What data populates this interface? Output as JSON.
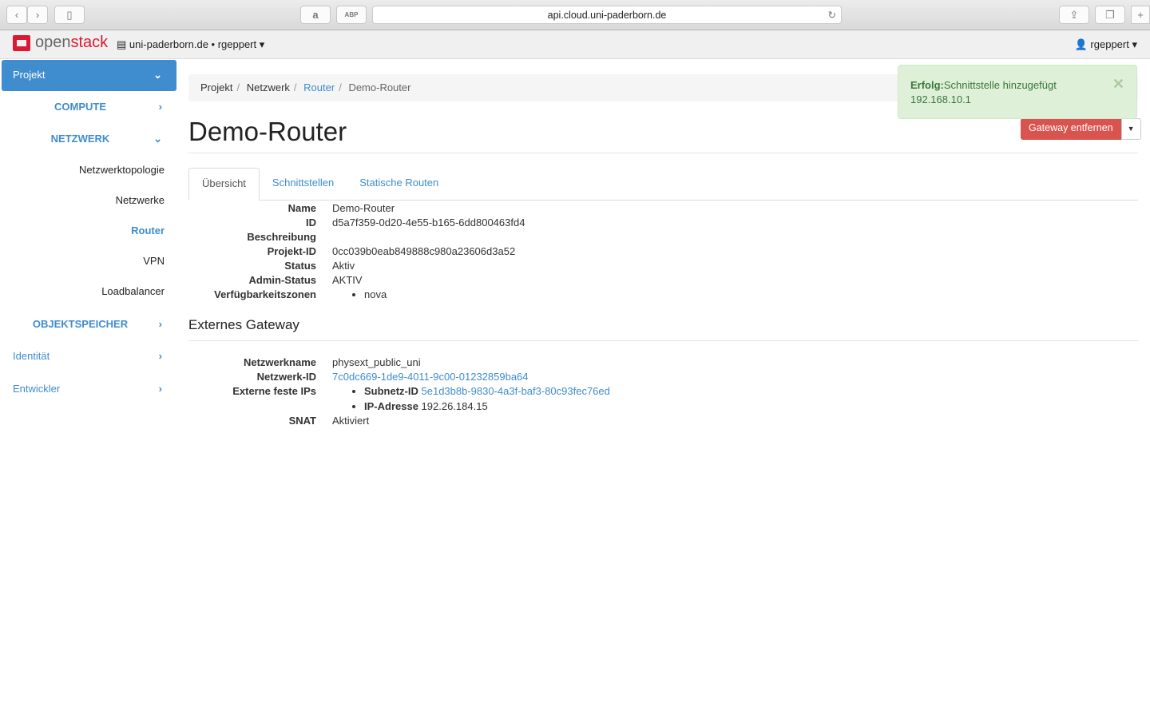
{
  "browser": {
    "url": "api.cloud.uni-paderborn.de"
  },
  "topbar": {
    "logo_a": "open",
    "logo_b": "stack",
    "project": "uni-paderborn.de • rgeppert",
    "user": "rgeppert"
  },
  "sidebar": {
    "top": "Projekt",
    "compute": "COMPUTE",
    "netzwerk": "NETZWERK",
    "items": [
      "Netzwerktopologie",
      "Netzwerke",
      "Router",
      "VPN",
      "Loadbalancer"
    ],
    "objekt": "OBJEKTSPEICHER",
    "identitaet": "Identität",
    "entwickler": "Entwickler"
  },
  "breadcrumb": [
    "Projekt",
    "Netzwerk",
    "Router",
    "Demo-Router"
  ],
  "title": "Demo-Router",
  "tabs": [
    "Übersicht",
    "Schnittstellen",
    "Statische Routen"
  ],
  "overview": {
    "labels": [
      "Name",
      "ID",
      "Beschreibung",
      "Projekt-ID",
      "Status",
      "Admin-Status",
      "Verfügbarkeitszonen"
    ],
    "values": [
      "Demo-Router",
      "d5a7f359-0d20-4e55-b165-6dd800463fd4",
      "",
      "0cc039b0eab849888c980a23606d3a52",
      "Aktiv",
      "AKTIV"
    ],
    "zones": [
      "nova"
    ]
  },
  "gateway": {
    "heading": "Externes Gateway",
    "net_name_label": "Netzwerkname",
    "net_name": "physext_public_uni",
    "net_id_label": "Netzwerk-ID",
    "net_id": "7c0dc669-1de9-4011-9c00-01232859ba64",
    "ips_label": "Externe feste IPs",
    "subnet_label": "Subnetz-ID",
    "subnet_id": "5e1d3b8b-9830-4a3f-baf3-80c93fec76ed",
    "ip_label": "IP-Adresse",
    "ip": "192.26.184.15",
    "snat_label": "SNAT",
    "snat": "Aktiviert"
  },
  "alert": {
    "strong": "Erfolg:",
    "text": "Schnittstelle hinzugefügt",
    "detail": "192.168.10.1"
  },
  "actions": {
    "gateway_remove": "Gateway entfernen"
  }
}
